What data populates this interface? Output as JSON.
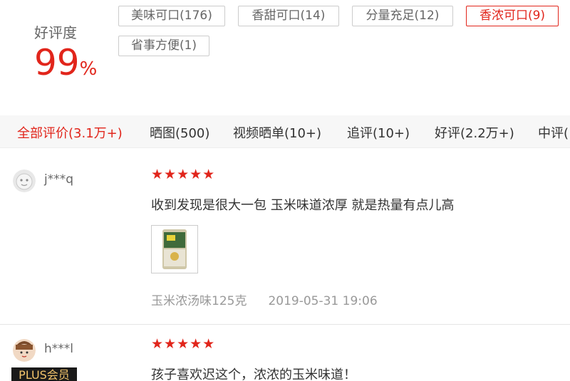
{
  "rating": {
    "label": "好评度",
    "value": "99",
    "unit": "%"
  },
  "tags": [
    {
      "label": "美味可口(176)",
      "active": false
    },
    {
      "label": "香甜可口(14)",
      "active": false
    },
    {
      "label": "分量充足(12)",
      "active": false
    },
    {
      "label": "香浓可口(9)",
      "active": true
    },
    {
      "label": "省事方便(1)",
      "active": false
    }
  ],
  "tabs": [
    {
      "label": "全部评价(3.1万+)",
      "active": true
    },
    {
      "label": "晒图(500)"
    },
    {
      "label": "视频晒单(10+)"
    },
    {
      "label": "追评(10+)"
    },
    {
      "label": "好评(2.2万+)"
    },
    {
      "label": "中评("
    }
  ],
  "reviews": [
    {
      "user": "j***q",
      "stars": "★★★★★",
      "star_count": 5,
      "text": "收到发现是很大一包 玉米味道浓厚 就是热量有点儿高",
      "variant": "玉米浓汤味125克",
      "date": "2019-05-31 19:06"
    },
    {
      "user": "h***l",
      "stars": "★★★★★",
      "star_count": 5,
      "text": "孩子喜欢迟这个，浓浓的玉米味道！",
      "badge": "PLUS会员"
    }
  ],
  "colors": {
    "accent": "#e1251b",
    "tab_bar": "#f7f7f7",
    "muted": "#999999"
  }
}
